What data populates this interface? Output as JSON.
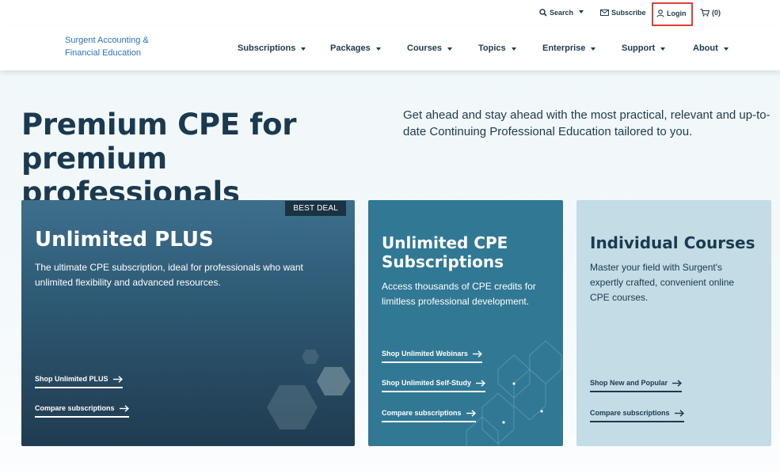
{
  "utility": {
    "search_label": "Search",
    "subscribe_label": "Subscribe",
    "login_label": "Login",
    "cart_label": "(0)"
  },
  "brand": {
    "line1": "Surgent Accounting &",
    "line2": "Financial Education"
  },
  "nav": {
    "items": [
      "Subscriptions",
      "Packages",
      "Courses",
      "Topics",
      "Enterprise",
      "Support",
      "About"
    ]
  },
  "hero": {
    "title_line1": "Premium CPE for",
    "title_line2": "premium professionals",
    "subtitle": "Get ahead and stay ahead with the most practical, relevant and up-to-date Continuing Professional Education tailored to you."
  },
  "cards": [
    {
      "badge": "BEST DEAL",
      "title": "Unlimited PLUS",
      "description": "The ultimate CPE subscription, ideal for professionals who want unlimited flexibility and advanced resources.",
      "links": [
        "Shop Unlimited PLUS",
        "Compare subscriptions"
      ]
    },
    {
      "title_line1": "Unlimited CPE",
      "title_line2": "Subscriptions",
      "description": "Access thousands of CPE credits for limitless professional development.",
      "links": [
        "Shop Unlimited Webinars",
        "Shop Unlimited Self-Study",
        "Compare subscriptions"
      ]
    },
    {
      "title": "Individual Courses",
      "description": "Master your field with Surgent's expertly crafted, convenient online CPE courses.",
      "links": [
        "Shop New and Popular",
        "Compare subscriptions"
      ]
    }
  ],
  "colors": {
    "brand_blue": "#2b72b8",
    "navy": "#1b3a4f",
    "highlight_red": "#e0403a",
    "card2_teal": "#317894",
    "card3_light": "#c3dce6"
  }
}
